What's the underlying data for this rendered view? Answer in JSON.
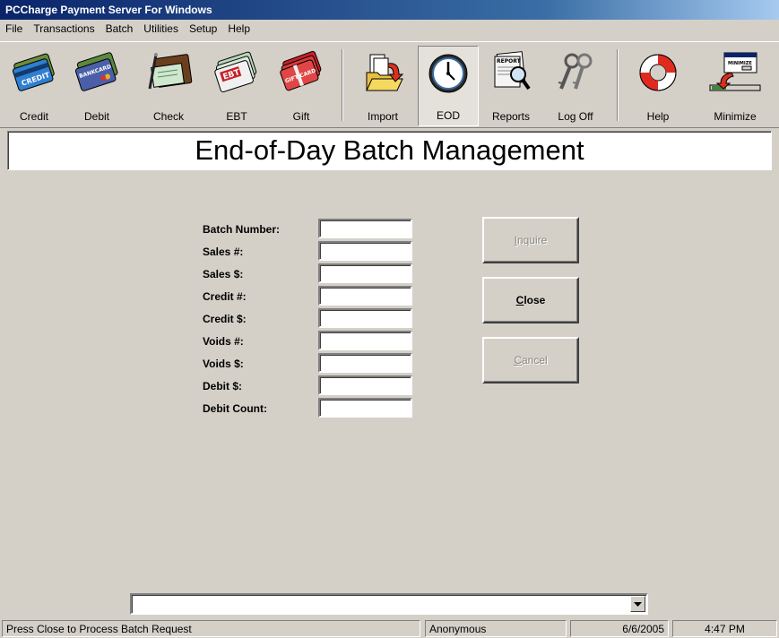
{
  "window": {
    "title": "PCCharge Payment Server For Windows"
  },
  "menu": [
    "File",
    "Transactions",
    "Batch",
    "Utilities",
    "Setup",
    "Help"
  ],
  "toolbar": {
    "credit": "Credit",
    "debit": "Debit",
    "check": "Check",
    "ebt": "EBT",
    "gift": "Gift",
    "import": "Import",
    "eod": "EOD",
    "reports": "Reports",
    "logoff": "Log Off",
    "help": "Help",
    "minimize": "Minimize",
    "icon_credit_text": "CREDIT",
    "icon_debit_text": "BANKCARD",
    "icon_ebt_text": "EBT",
    "icon_gift_text": "GIFT CARD",
    "icon_report_text": "REPORT",
    "icon_minimize_text": "MINIMIZE"
  },
  "banner": {
    "title": "End-of-Day Batch Management"
  },
  "fields": [
    {
      "label": "Batch Number:",
      "value": ""
    },
    {
      "label": "Sales #:",
      "value": ""
    },
    {
      "label": "Sales $:",
      "value": ""
    },
    {
      "label": "Credit #:",
      "value": ""
    },
    {
      "label": "Credit $:",
      "value": ""
    },
    {
      "label": "Voids #:",
      "value": ""
    },
    {
      "label": "Voids $:",
      "value": ""
    },
    {
      "label": "Debit $:",
      "value": ""
    },
    {
      "label": "Debit Count:",
      "value": ""
    }
  ],
  "buttons": {
    "inquire": {
      "accel": "I",
      "rest": "nquire"
    },
    "close": {
      "accel": "C",
      "rest": "lose"
    },
    "cancel": {
      "accel": "C",
      "rest": "ancel"
    }
  },
  "combo": {
    "value": ""
  },
  "status": {
    "message": "Press Close to Process Batch Request",
    "user": "Anonymous",
    "date": "6/6/2005",
    "time": "4:47 PM"
  },
  "colors": {
    "title_start": "#0a246a",
    "face": "#d4d0c8",
    "disabled_text": "#8a8780"
  }
}
